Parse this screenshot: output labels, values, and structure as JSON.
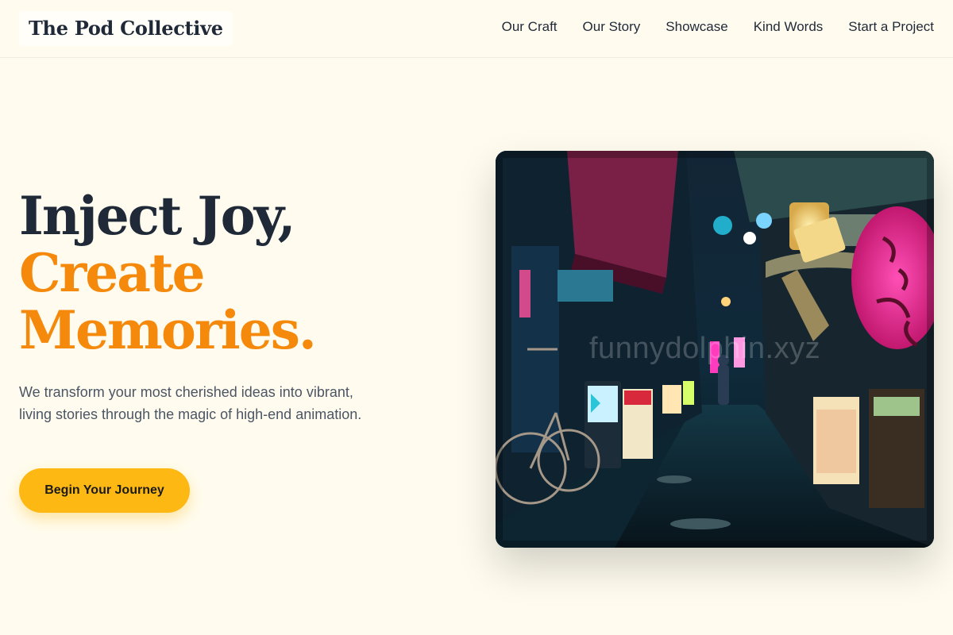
{
  "brand": {
    "name": "The Pod Collective"
  },
  "nav": {
    "items": [
      {
        "label": "Our Craft"
      },
      {
        "label": "Our Story"
      },
      {
        "label": "Showcase"
      },
      {
        "label": "Kind Words"
      },
      {
        "label": "Start a Project"
      }
    ]
  },
  "hero": {
    "headline_line1": "Inject Joy,",
    "headline_line2": "Create",
    "headline_line3": "Memories.",
    "subtitle": "We transform your most cherished ideas into vibrant, living stories through the magic of high-end animation.",
    "cta_label": "Begin Your Journey",
    "image_watermark": "funnydolphin.xyz"
  },
  "colors": {
    "background": "#fffcef",
    "heading_dark": "#1f2937",
    "accent_orange": "#f5890c",
    "button_yellow": "#fdb813",
    "body_text": "#4b5563"
  }
}
